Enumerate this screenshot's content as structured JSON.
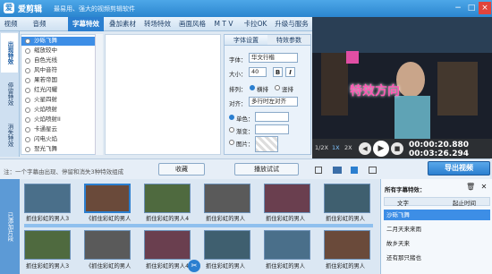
{
  "app": {
    "name": "爱剪辑",
    "slogan": "最易用、强大的视频剪辑软件"
  },
  "window_buttons": [
    "−",
    "□",
    "×"
  ],
  "tabs": [
    "视频",
    "音频",
    "字幕特效",
    "叠加素材",
    "转场特效",
    "画面风格",
    "M T V",
    "卡拉OK",
    "升级与服务"
  ],
  "active_tab": "字幕特效",
  "side_tabs": [
    "出现特效",
    "停留特效",
    "消失特效"
  ],
  "effects": [
    "沙砾飞舞",
    "缩放较中",
    "自色光线",
    "风中音符",
    "果若帝国",
    "红光闪耀",
    "火星四射",
    "火焰喷射",
    "火焰喷射II",
    "卡通星云",
    "闪电火焰",
    "翌光飞舞"
  ],
  "selected_effect": "沙砾飞舞",
  "settings": {
    "tab1": "字体设置",
    "tab2": "特效参数",
    "font_label": "字体：",
    "font_value": "华文行楷",
    "size_label": "大小：",
    "size_value": "40",
    "bold": "B",
    "italic": "I",
    "arrange_label": "排列：",
    "horizontal": "横排",
    "vertical": "竖排",
    "align_label": "对齐：",
    "align_value": "多行时左对齐",
    "single_color": "单色：",
    "gradient": "渐变：",
    "image": "图片："
  },
  "hint": {
    "text": "注：一个字幕由出现、停留和消失3种特效组成",
    "collect": "收藏",
    "preview_btn": "播放试试"
  },
  "video": {
    "overlay_text": "特效方向",
    "speeds": [
      "1/2X",
      "1X",
      "2X"
    ],
    "time_current": "00:00:20.880",
    "time_total": "00:03:26.294",
    "export": "导出视频"
  },
  "timeline": {
    "track_label": "已添加片段",
    "clips": [
      "抓住彩虹的男人3",
      "《抓住彩虹的男人",
      "抓住彩虹的男人4",
      "抓住彩虹的男人",
      "抓住彩虹的男人",
      "抓住彩虹的男人"
    ]
  },
  "rpanel": {
    "title": "所有字幕特效：",
    "col1": "文字",
    "col2": "起止时间",
    "rows": [
      "沙砾飞舞",
      "二月天来来雨",
      "故乡天来",
      "还有那只猪也"
    ]
  }
}
